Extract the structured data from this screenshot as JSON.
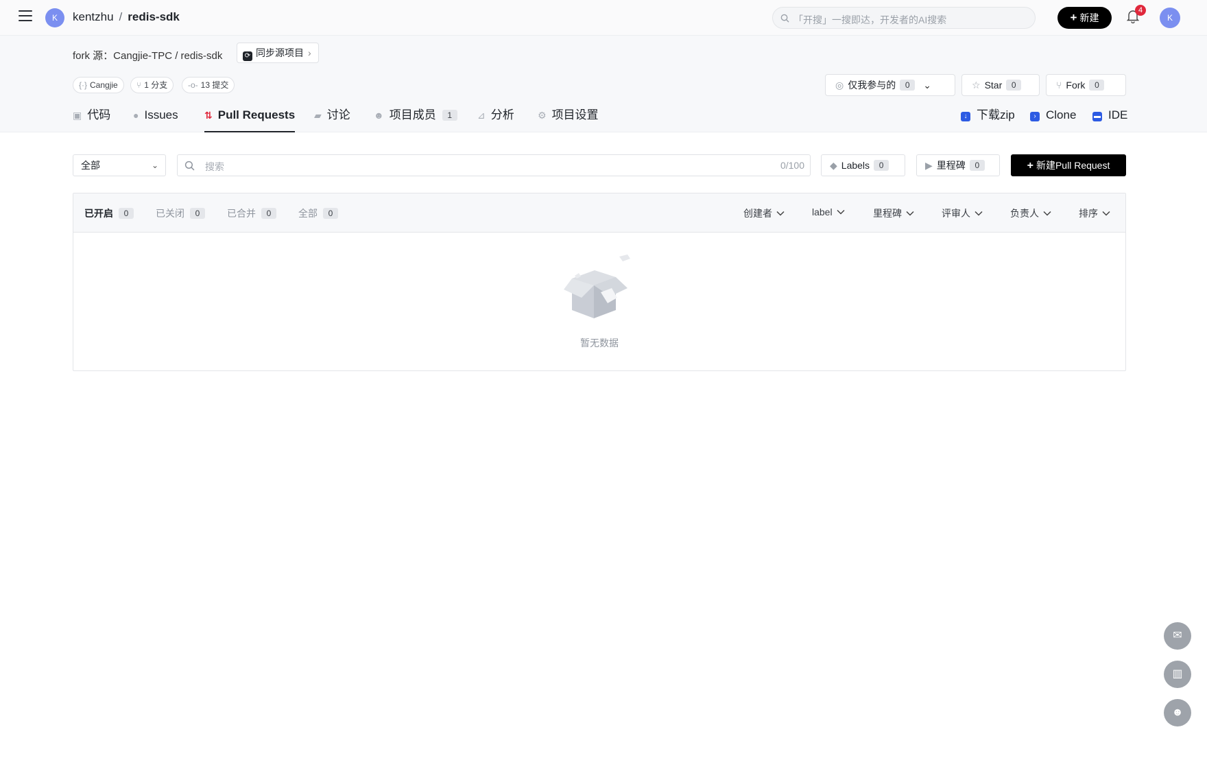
{
  "header": {
    "user_initial": "K",
    "owner": "kentzhu",
    "separator": "/",
    "repo": "redis-sdk",
    "search_placeholder": "「开搜」一搜即达，开发者的AI搜索",
    "new_label": "新建",
    "notification_count": "4",
    "avatar_initial": "K"
  },
  "repo": {
    "fork_source": "fork 源：Cangjie-TPC / redis-sdk",
    "sync_label": "同步源项目",
    "language": "Cangjie",
    "branches": "1 分支",
    "commits": "13 提交",
    "watch": {
      "label": "仅我参与的",
      "count": "0"
    },
    "star": {
      "label": "Star",
      "count": "0"
    },
    "fork": {
      "label": "Fork",
      "count": "0"
    }
  },
  "tabs": [
    {
      "label": "代码"
    },
    {
      "label": "Issues"
    },
    {
      "label": "Pull Requests"
    },
    {
      "label": "讨论"
    },
    {
      "label": "项目成员",
      "count": "1"
    },
    {
      "label": "分析"
    },
    {
      "label": "项目设置"
    }
  ],
  "actions": {
    "download": "下载zip",
    "clone": "Clone",
    "ide": "IDE"
  },
  "filters": {
    "scope": "全部",
    "search_placeholder": "搜索",
    "search_counter": "0/100",
    "labels": {
      "label": "Labels",
      "count": "0"
    },
    "milestones": {
      "label": "里程碑",
      "count": "0"
    },
    "new_pr": "新建Pull Request"
  },
  "list": {
    "state_tabs": [
      {
        "label": "已开启",
        "count": "0"
      },
      {
        "label": "已关闭",
        "count": "0"
      },
      {
        "label": "已合并",
        "count": "0"
      },
      {
        "label": "全部",
        "count": "0"
      }
    ],
    "dropdowns": [
      "创建者",
      "label",
      "里程碑",
      "评审人",
      "负责人",
      "排序"
    ],
    "empty_text": "暂无数据"
  },
  "colors": {
    "accent": "#e0283c",
    "primary_button": "#000000",
    "link_icon": "#2d5be3"
  },
  "icons": [
    "menu-icon",
    "search-icon",
    "bell-icon",
    "sync-icon",
    "code-icon",
    "branch-icon",
    "commit-icon",
    "eye-icon",
    "star-icon",
    "fork-icon",
    "tag-icon",
    "milestone-icon",
    "download-icon",
    "terminal-icon",
    "ide-icon",
    "mail-icon",
    "building-icon",
    "smile-icon"
  ]
}
